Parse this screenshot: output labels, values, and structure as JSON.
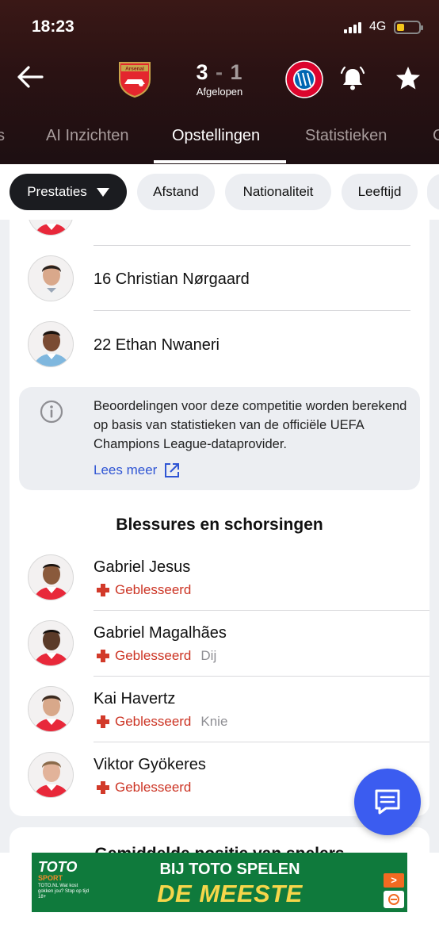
{
  "status_bar": {
    "time": "18:23",
    "network": "4G"
  },
  "match": {
    "home_team": "Arsenal",
    "home_score": "3",
    "separator": "-",
    "away_score": "1",
    "status": "Afgelopen",
    "away_crest_text": "FC BAYERN MÜNCHEN"
  },
  "tabs": [
    "s",
    "AI Inzichten",
    "Opstellingen",
    "Statistieken",
    "C"
  ],
  "active_tab": "Opstellingen",
  "filters": [
    "Prestaties",
    "Afstand",
    "Nationaliteit",
    "Leeftijd"
  ],
  "players": [
    {
      "number": "16",
      "name": "Christian Nørgaard",
      "label": "16 Christian Nørgaard"
    },
    {
      "number": "22",
      "name": "Ethan Nwaneri",
      "label": "22 Ethan Nwaneri"
    }
  ],
  "info_box": {
    "text": "Beoordelingen voor deze competitie worden berekend op basis van statistieken van de officiële UEFA Champions League-dataprovider.",
    "link": "Lees meer"
  },
  "injuries": {
    "title": "Blessures en schorsingen",
    "items": [
      {
        "name": "Gabriel Jesus",
        "status": "Geblesseerd",
        "reason": ""
      },
      {
        "name": "Gabriel Magalhães",
        "status": "Geblesseerd",
        "reason": "Dij"
      },
      {
        "name": "Kai Havertz",
        "status": "Geblesseerd",
        "reason": "Knie"
      },
      {
        "name": "Viktor Gyökeres",
        "status": "Geblesseerd",
        "reason": ""
      }
    ]
  },
  "next_section_title": "Gemiddelde positie van spelers",
  "ad": {
    "brand": "TOTO",
    "brand_sub": "SPORT",
    "small_print": "TOTO.NL Wat kost gokken jou? Stop op tijd 18+",
    "line1": "BIJ TOTO SPELEN",
    "line2": "DE MEESTE SPELERS!",
    "cta": ">"
  },
  "colors": {
    "accent": "#3b5cf0",
    "injury": "#cc3424",
    "link": "#2f55d4",
    "header_bg": "#2a1213"
  }
}
